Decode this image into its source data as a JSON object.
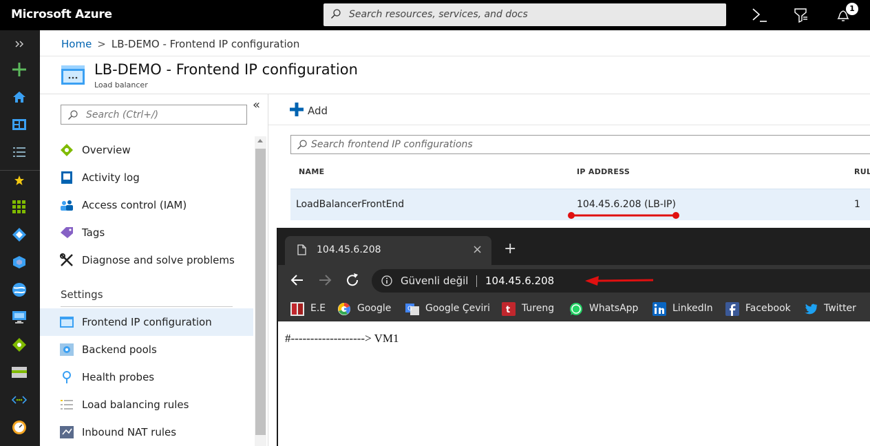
{
  "topbar": {
    "brand": "Microsoft Azure",
    "search_placeholder": "Search resources, services, and docs",
    "notification_count": "1"
  },
  "breadcrumb": {
    "home": "Home",
    "current": "LB-DEMO - Frontend IP configuration"
  },
  "resource": {
    "title": "LB-DEMO - Frontend IP configuration",
    "subtitle": "Load balancer"
  },
  "menu": {
    "search_placeholder": "Search (Ctrl+/)",
    "collapse_label": "«",
    "items": [
      {
        "label": "Overview"
      },
      {
        "label": "Activity log"
      },
      {
        "label": "Access control (IAM)"
      },
      {
        "label": "Tags"
      },
      {
        "label": "Diagnose and solve problems"
      }
    ],
    "settings_label": "Settings",
    "settings_items": [
      {
        "label": "Frontend IP configuration"
      },
      {
        "label": "Backend pools"
      },
      {
        "label": "Health probes"
      },
      {
        "label": "Load balancing rules"
      },
      {
        "label": "Inbound NAT rules"
      }
    ]
  },
  "content": {
    "add_label": "Add",
    "search_placeholder": "Search frontend IP configurations",
    "columns": [
      "NAME",
      "IP ADDRESS",
      "RUL"
    ],
    "rows": [
      {
        "name": "LoadBalancerFrontEnd",
        "ip": "104.45.6.208 (LB-IP)",
        "rules": "1"
      }
    ]
  },
  "browser": {
    "tab_title": "104.45.6.208",
    "tab_close": "×",
    "new_tab": "+",
    "security_text": "Güvenli değil",
    "url": "104.45.6.208",
    "bookmarks": [
      {
        "label": "E.E"
      },
      {
        "label": "Google"
      },
      {
        "label": "Google Çeviri"
      },
      {
        "label": "Tureng"
      },
      {
        "label": "WhatsApp"
      },
      {
        "label": "LinkedIn"
      },
      {
        "label": "Facebook"
      },
      {
        "label": "Twitter"
      }
    ],
    "page_text": "#-------------------> VM1"
  },
  "colors": {
    "azure_blue": "#0063b1",
    "annotation_red": "#e01010",
    "topbar_bg": "#000000",
    "rail_bg": "#1f1f1f",
    "selected_bg": "#e6f0fa"
  }
}
